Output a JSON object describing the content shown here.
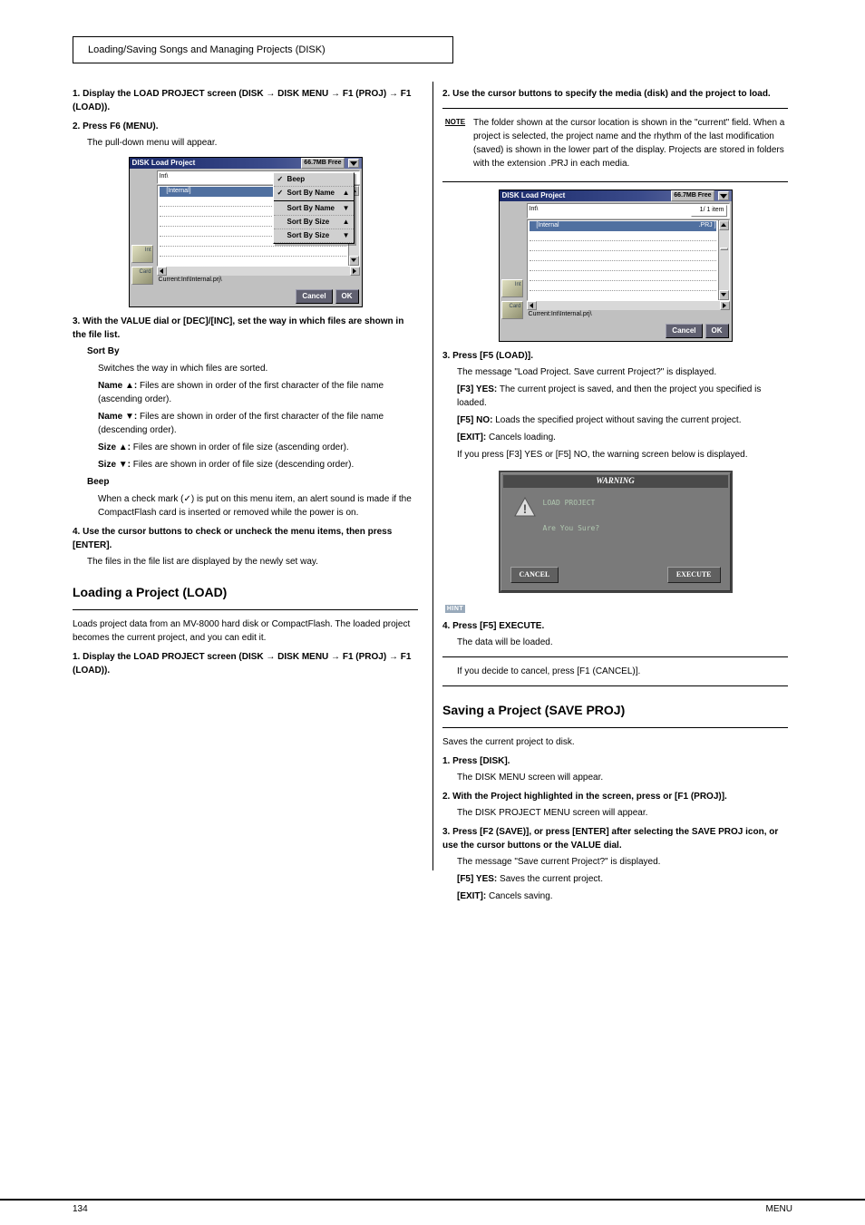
{
  "header": {
    "title": "Loading/Saving Songs and Managing Projects (DISK)"
  },
  "leftCol": {
    "h1": "1. Display the LOAD PROJECT screen (DISK → DISK MENU → F1 (PROJ) → F1 (LOAD)).",
    "h2": "2. Press F6 (MENU).",
    "p2": "The pull-down menu will appear.",
    "h3": "3. With the VALUE dial or [DEC]/[INC], set the way in which files are shown in the file list.",
    "sort_heading": "Sort By",
    "sort_body": "Switches the way in which files are sorted.",
    "sort_name_asc_l": "Name ▲:",
    "sort_name_asc_v": "Files are shown in order of the first character of the file name (ascending order).",
    "sort_name_desc_l": "Name ▼:",
    "sort_name_desc_v": "Files are shown in order of the first character of the file name (descending order).",
    "sort_size_asc_l": "Size ▲:",
    "sort_size_asc_v": "Files are shown in order of file size (ascending order).",
    "sort_size_desc_l": "Size ▼:",
    "sort_size_desc_v": "Files are shown in order of file size (descending order).",
    "beep_heading": "Beep",
    "beep_body": "When a check mark (✓) is put on this menu item, an alert sound is made if the CompactFlash card is inserted or removed while the power is on.",
    "h4": "4. Use the cursor buttons to check or uncheck the menu items, then press [ENTER].",
    "p4": "The files in the file list are displayed by the newly set way.",
    "load_title": "Loading a Project (LOAD)",
    "load_body": "Loads project data from an MV-8000 hard disk or CompactFlash. The loaded project becomes the current project, and you can edit it.",
    "h5": "1. Display the LOAD PROJECT screen (DISK → DISK MENU → F1 (PROJ) → F1 (LOAD))."
  },
  "rightCol": {
    "h6": "2. Use the cursor buttons to specify the media (disk) and the project to load.",
    "note1": "The folder shown at the cursor location is shown in the \"current\" field. When a project is selected, the project name and the rhythm of the last modification (saved) is shown in the lower part of the display. Projects are stored in folders with the extension .PRJ in each media.",
    "h7": "3. Press [F5 (LOAD)].",
    "p7": "The message \"Load Project. Save current Project?\" is displayed.",
    "opt1_btn": "[F3] YES:",
    "opt1_txt": "The current project is saved, and then the project you specified is loaded.",
    "opt2_btn": "[F5] NO:",
    "opt2_txt": "Loads the specified project without saving the current project.",
    "opt3_btn": "[EXIT]:",
    "opt3_txt": "Cancels loading.",
    "warn_caption": "If you press [F3] YES or [F5] NO, the warning screen below is displayed.",
    "h8": "4. Press [F5] EXECUTE.",
    "p8": "The data will be loaded.",
    "hint1": "If you decide to cancel, press [F1 (CANCEL)].",
    "save_title": "Saving a Project (SAVE PROJ)",
    "save_body": "Saves the current project to disk.",
    "h9": "1. Press [DISK].",
    "p9": "The DISK MENU screen will appear.",
    "h10": "2. With the Project highlighted in the screen, press or [F1 (PROJ)].",
    "p10": "The DISK PROJECT MENU screen will appear.",
    "h11": "3. Press [F2 (SAVE)], or press [ENTER] after selecting the SAVE PROJ icon, or use the cursor buttons or the VALUE dial.",
    "p11": "The message \"Save current Project?\" is displayed.",
    "save_opt1_btn": "[F5] YES:",
    "save_opt1_txt": "Saves the current project.",
    "save_opt2_btn": "[EXIT]:",
    "save_opt2_txt": "Cancels saving."
  },
  "dialog1": {
    "title": "DISK Load Project",
    "freeText": "66.7MB Free",
    "pathShort": "Int\\",
    "row1": "[Internal]",
    "statusLine": "Current:Int\\Internal.prj\\",
    "cancel": "Cancel",
    "ok": "OK",
    "driveInt": "Int",
    "driveCard": "Card",
    "menu": {
      "beep": "Beep",
      "sbNameA": "Sort By Name",
      "sbNameD": "Sort By Name",
      "sbSizeA": "Sort By Size",
      "sbSizeD": "Sort By Size"
    }
  },
  "dialog2": {
    "title": "DISK Load Project",
    "freeText": "66.7MB Free",
    "pathShort": "Int\\",
    "countText": "1/ 1 item",
    "rowName": "[Internal",
    "rowExt": ".PRJ ]",
    "statusLine": "Current:Int\\Internal.prj\\",
    "cancel": "Cancel",
    "ok": "OK",
    "driveInt": "Int",
    "driveCard": "Card"
  },
  "warningDialog": {
    "title": "WARNING",
    "line1": "LOAD PROJECT",
    "line2": "Are You Sure?",
    "cancel": "CANCEL",
    "execute": "EXECUTE"
  },
  "footer": {
    "pageNum": "134",
    "section": "MENU"
  }
}
